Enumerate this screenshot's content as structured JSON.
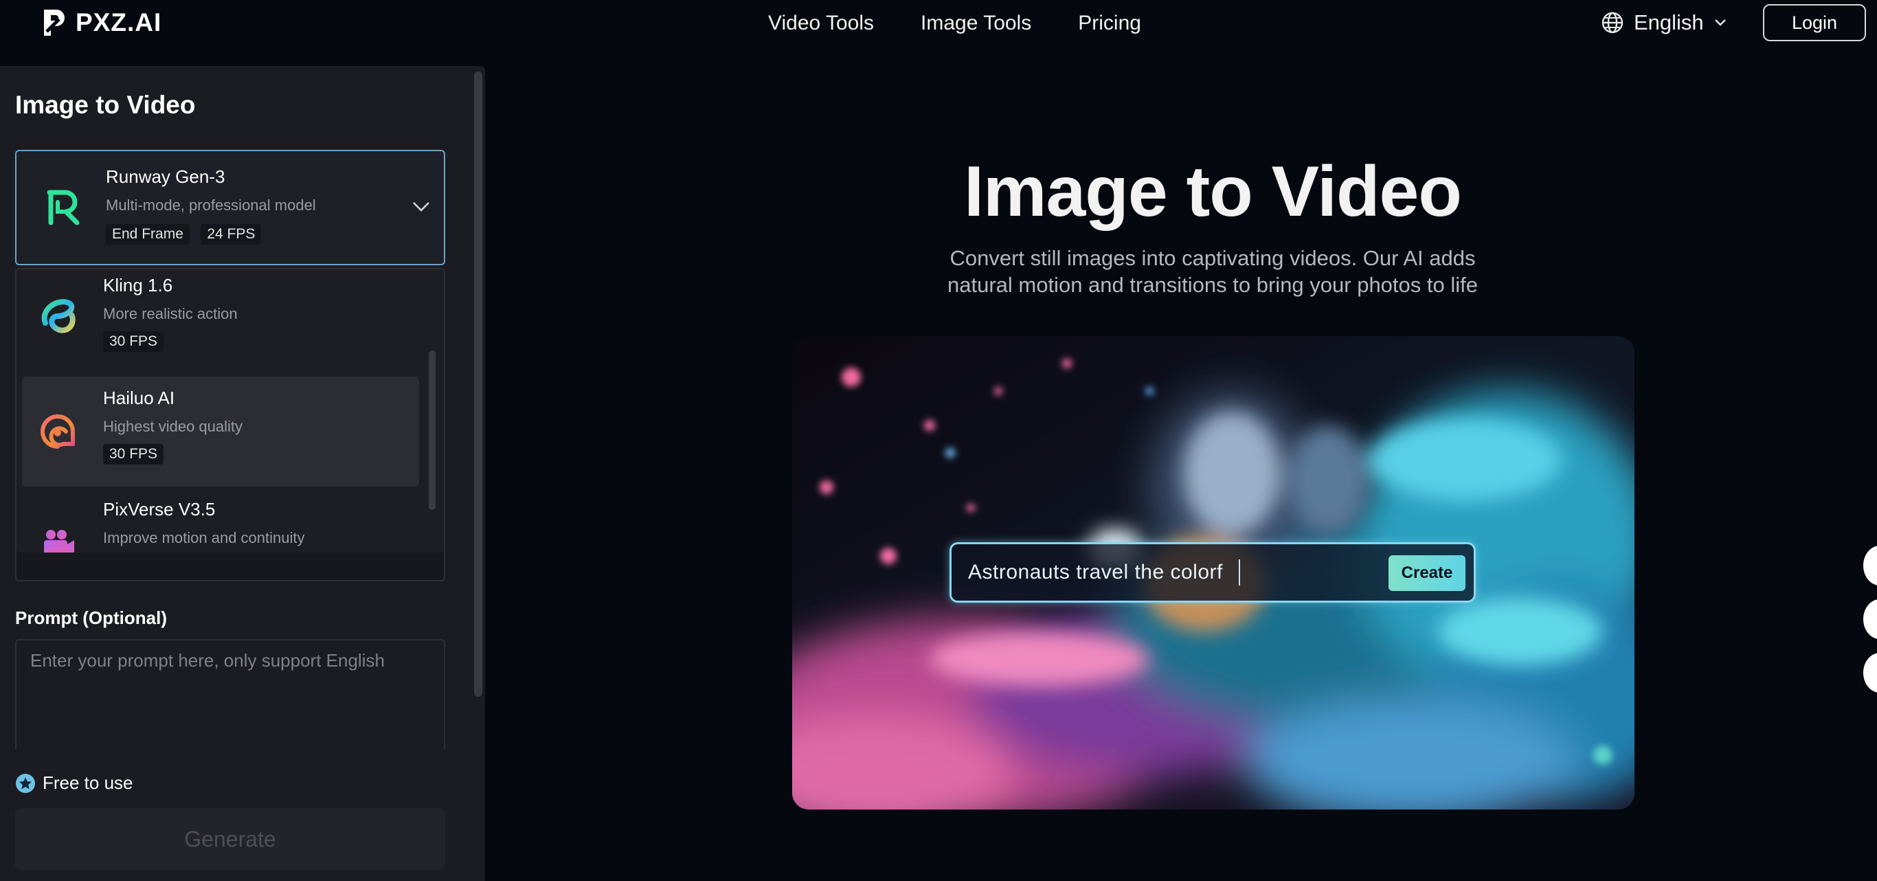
{
  "header": {
    "brand": "PXZ.AI",
    "nav": [
      "Video Tools",
      "Image Tools",
      "Pricing"
    ],
    "language": "English",
    "login_label": "Login"
  },
  "sidebar": {
    "title": "Image to Video",
    "selected_model": {
      "name": "Runway Gen-3",
      "description": "Multi-mode, professional model",
      "tags": [
        "End Frame",
        "24 FPS"
      ]
    },
    "models": [
      {
        "name": "Kling 1.6",
        "description": "More realistic action",
        "tags": [
          "30 FPS"
        ]
      },
      {
        "name": "Hailuo AI",
        "description": "Highest video quality",
        "tags": [
          "30 FPS"
        ]
      },
      {
        "name": "PixVerse V3.5",
        "description": "Improve motion and continuity",
        "tags": []
      }
    ],
    "prompt_label": "Prompt (Optional)",
    "prompt_placeholder": "Enter your prompt here, only support English",
    "free_label": "Free to use",
    "generate_label": "Generate"
  },
  "hero": {
    "title": "Image to Video",
    "subtitle_line1": "Convert still images into captivating videos. Our AI adds",
    "subtitle_line2": "natural motion and transitions to bring your photos to life",
    "demo_prompt": "Astronauts travel the colorf",
    "create_label": "Create"
  },
  "colors": {
    "background": "#05080f",
    "sidebar": "#1b1c21",
    "accent": "#6fa3c8",
    "create_gradient_start": "#7fe1c9",
    "create_gradient_end": "#5fd3e6"
  }
}
